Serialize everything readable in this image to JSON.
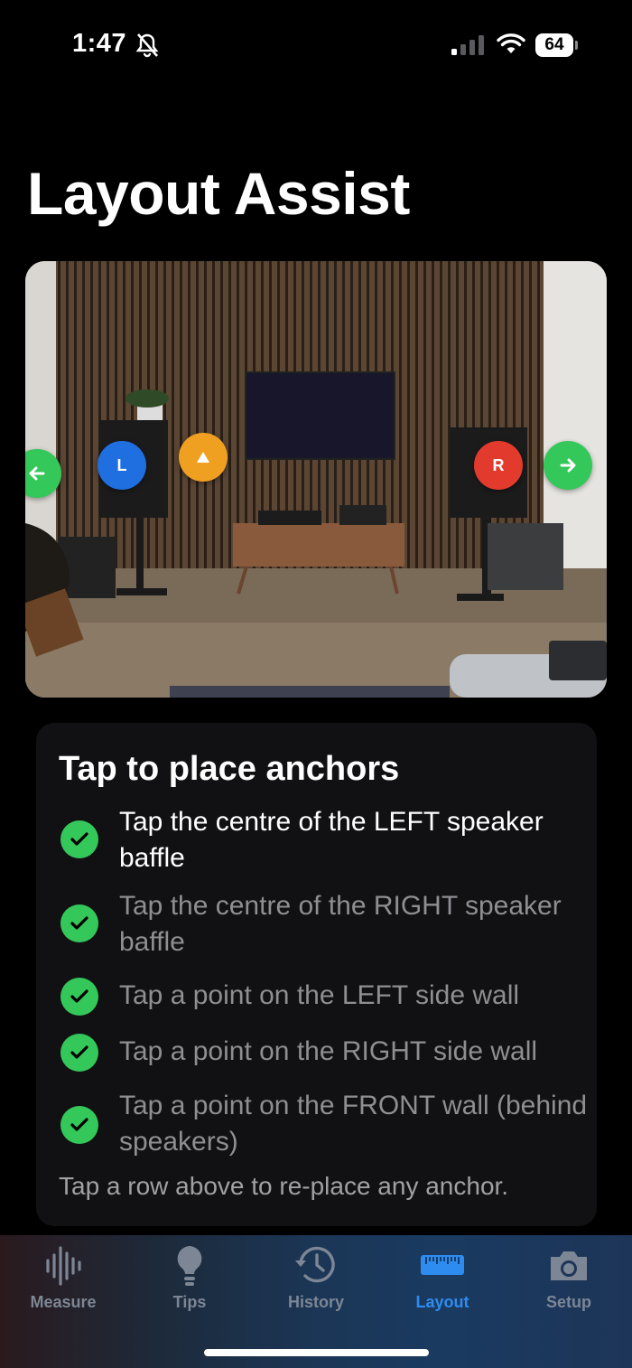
{
  "status_bar": {
    "time": "1:47",
    "battery": "64",
    "icons": [
      "bell-slash-icon",
      "cellular-signal-icon",
      "wifi-icon",
      "battery-icon"
    ]
  },
  "page": {
    "title": "Layout Assist"
  },
  "photo": {
    "anchors": {
      "left_speaker": "L",
      "right_speaker": "R",
      "front_wall_icon": "triangle-icon",
      "left_wall_icon": "arrow-left-icon",
      "right_wall_icon": "arrow-right-icon"
    },
    "colors": {
      "left_speaker": "#1f6fe0",
      "right_speaker": "#e23b2e",
      "front_wall": "#f0a020",
      "side_walls": "#34c759"
    }
  },
  "instructions": {
    "title": "Tap to place anchors",
    "steps": [
      {
        "text": "Tap the centre of the LEFT speaker baffle",
        "done": true,
        "active": true
      },
      {
        "text": "Tap the centre of the RIGHT speaker baffle",
        "done": true,
        "active": false
      },
      {
        "text": "Tap a point on the LEFT side wall",
        "done": true,
        "active": false
      },
      {
        "text": "Tap a point on the RIGHT side wall",
        "done": true,
        "active": false
      },
      {
        "text": "Tap a point on the FRONT wall (behind speakers)",
        "done": true,
        "active": false
      }
    ],
    "footer": "Tap a row above to re-place any anchor."
  },
  "tab_bar": {
    "tabs": [
      {
        "label": "Measure",
        "icon": "waveform-icon",
        "active": false
      },
      {
        "label": "Tips",
        "icon": "lightbulb-icon",
        "active": false
      },
      {
        "label": "History",
        "icon": "history-clock-icon",
        "active": false
      },
      {
        "label": "Layout",
        "icon": "ruler-icon",
        "active": true
      },
      {
        "label": "Setup",
        "icon": "camera-icon",
        "active": false
      }
    ],
    "active_color": "#2e8cf0",
    "inactive_color": "#7d8694"
  }
}
